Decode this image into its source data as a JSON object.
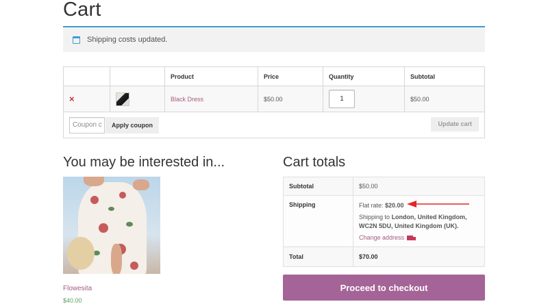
{
  "page": {
    "title": "Cart"
  },
  "notice": {
    "icon": "info-window-icon",
    "message": "Shipping costs updated."
  },
  "cart_table": {
    "headers": [
      "",
      "",
      "Product",
      "Price",
      "Quantity",
      "Subtotal"
    ],
    "items": [
      {
        "remove": "×",
        "thumbnail_icon": "black-dress-thumbnail",
        "product": "Black Dress",
        "price": "$50.00",
        "quantity": "1",
        "subtotal": "$50.00"
      }
    ],
    "coupon_placeholder": "Coupon c",
    "apply_coupon": "Apply coupon",
    "update_cart": "Update cart"
  },
  "related": {
    "heading": "You may be interested in...",
    "product_name": "Flowesita",
    "product_price": "$40.00"
  },
  "totals": {
    "heading": "Cart totals",
    "subtotal_label": "Subtotal",
    "subtotal_value": "$50.00",
    "shipping_label": "Shipping",
    "flat_rate_label": "Flat rate:",
    "flat_rate_value": "$20.00",
    "shipping_to_prefix": "Shipping to",
    "shipping_to_address": "London, United Kingdom, WC2N 5DU, United Kingdom (UK).",
    "change_address": "Change address",
    "total_label": "Total",
    "total_value": "$70.00",
    "checkout_button": "Proceed to checkout"
  },
  "colors": {
    "notice_border": "#3d9cd2",
    "link": "#a45b7e",
    "price_green": "#58a05c",
    "checkout_button": "#a46497",
    "remove_red": "#d32e2e",
    "arrow_red": "#e3262a"
  }
}
